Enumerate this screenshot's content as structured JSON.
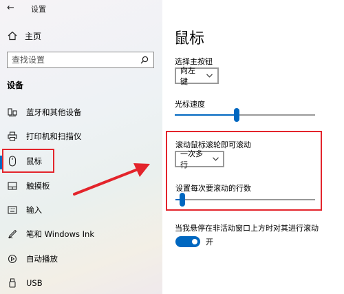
{
  "window": {
    "title": "设置"
  },
  "sidebar": {
    "home_label": "主页",
    "search_placeholder": "查找设置",
    "section_label": "设备",
    "items": [
      {
        "label": "蓝牙和其他设备",
        "icon": "bluetooth-icon"
      },
      {
        "label": "打印机和扫描仪",
        "icon": "printer-icon"
      },
      {
        "label": "鼠标",
        "icon": "mouse-icon",
        "active": true
      },
      {
        "label": "触摸板",
        "icon": "touchpad-icon"
      },
      {
        "label": "输入",
        "icon": "keyboard-icon"
      },
      {
        "label": "笔和 Windows Ink",
        "icon": "pen-icon"
      },
      {
        "label": "自动播放",
        "icon": "autoplay-icon"
      },
      {
        "label": "USB",
        "icon": "usb-icon"
      }
    ]
  },
  "main": {
    "title": "鼠标",
    "primary_button": {
      "label": "选择主按钮",
      "value": "向左键"
    },
    "cursor_speed": {
      "label": "光标速度",
      "level": 0.44
    },
    "scroll_mode": {
      "label": "滚动鼠标滚轮即可滚动",
      "value": "一次多行"
    },
    "scroll_lines": {
      "label": "设置每次要滚动的行数",
      "level": 0.03
    },
    "inactive_scroll": {
      "label": "当我悬停在非活动窗口上方时对其进行滚动",
      "toggle_text": "开",
      "on": true
    }
  },
  "colors": {
    "accent": "#0067c0",
    "highlight": "#e3242b"
  }
}
